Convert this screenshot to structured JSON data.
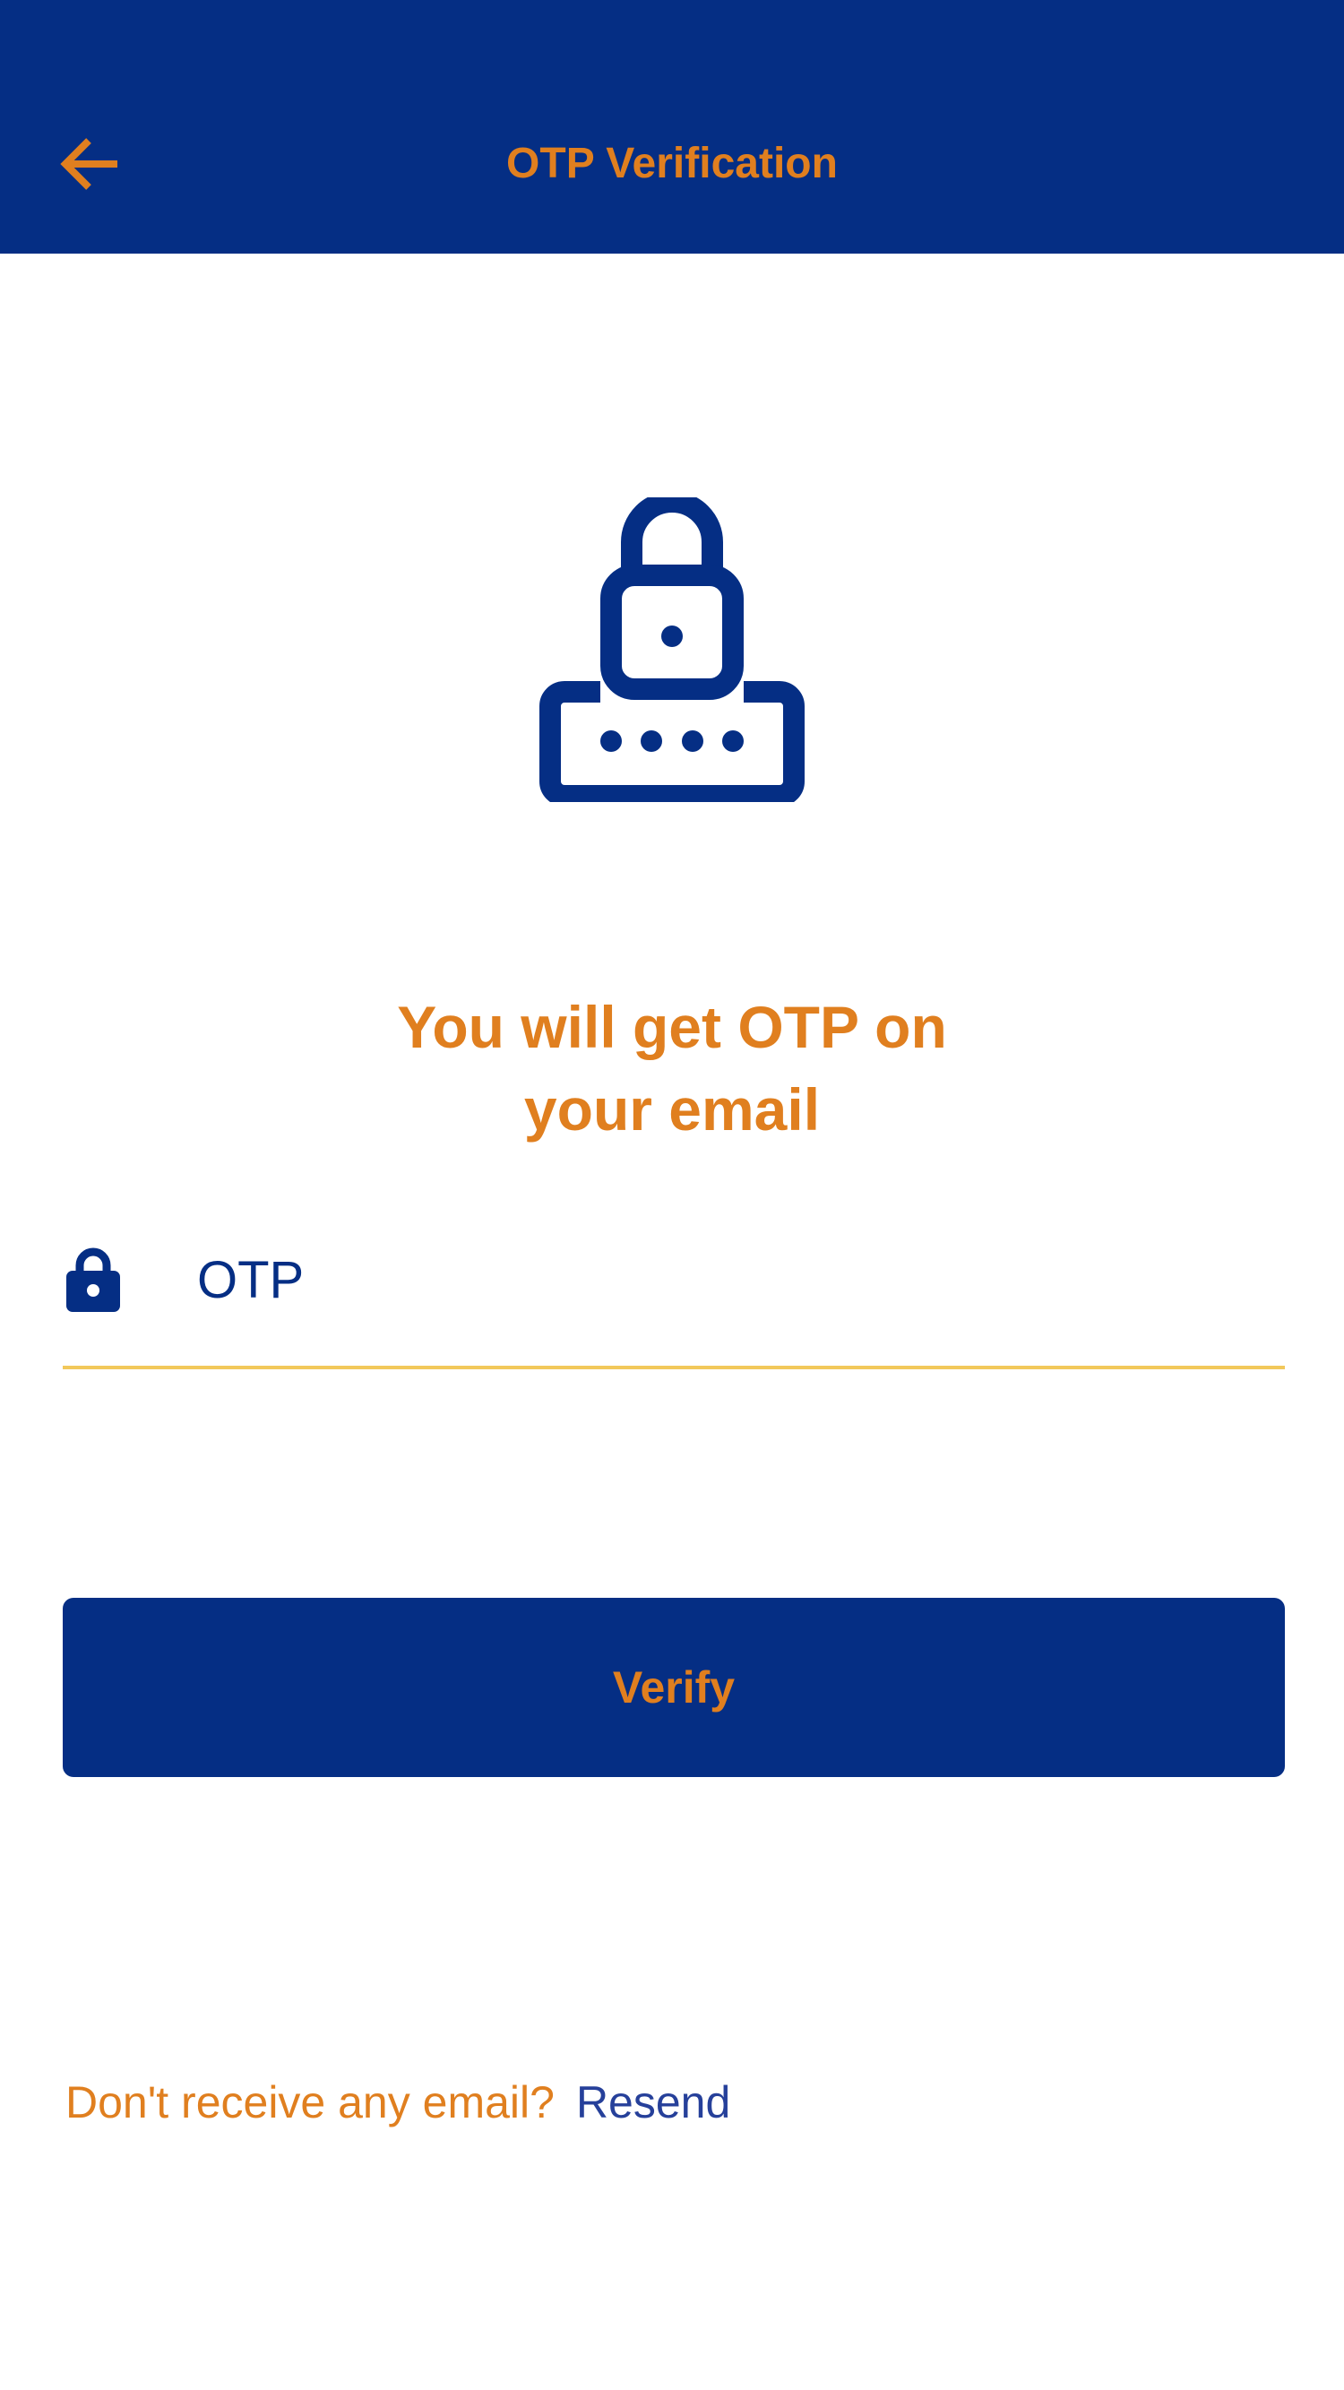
{
  "app_bar": {
    "title": "OTP Verification",
    "back_icon": "arrow-left-icon"
  },
  "hero": {
    "icon": "password-lock-icon"
  },
  "headline": {
    "line1": "You will get OTP on",
    "line2": "your email"
  },
  "otp_field": {
    "icon": "lock-icon",
    "placeholder": "OTP",
    "value": ""
  },
  "verify_button": {
    "label": "Verify"
  },
  "resend": {
    "prompt": "Don't receive any email?",
    "link": "Resend"
  },
  "colors": {
    "primary": "#052e84",
    "accent": "#e07f1f",
    "underline": "#f2c85b",
    "link": "#26409a",
    "background": "#ffffff"
  }
}
